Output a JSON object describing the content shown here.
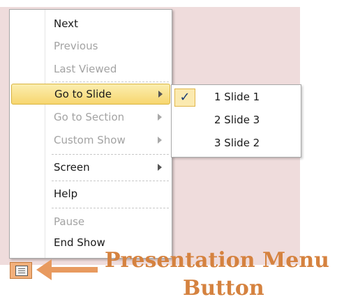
{
  "menu": {
    "items": [
      {
        "label": "Next",
        "enabled": true
      },
      {
        "label": "Previous",
        "enabled": false
      },
      {
        "label": "Last Viewed",
        "enabled": false
      },
      {
        "label": "Go to Slide",
        "enabled": true,
        "highlighted": true,
        "submenu": true
      },
      {
        "label": "Go to Section",
        "enabled": false,
        "submenu": true
      },
      {
        "label": "Custom Show",
        "enabled": false,
        "submenu": true
      },
      {
        "label": "Screen",
        "enabled": true,
        "submenu": true
      },
      {
        "label": "Help",
        "enabled": true
      },
      {
        "label": "Pause",
        "enabled": false
      },
      {
        "label": "End Show",
        "enabled": true
      }
    ]
  },
  "submenu": {
    "items": [
      {
        "label": "1  Slide 1",
        "checked": true
      },
      {
        "label": "2 Slide 3",
        "checked": false
      },
      {
        "label": "3 Slide 2",
        "checked": false
      }
    ],
    "check_glyph": "✓"
  },
  "caption": {
    "line1": "Presentation  Menu",
    "line2": "Button"
  },
  "colors": {
    "slide_background": "#efdcdc",
    "highlight": "#f7d66f",
    "callout": "#d5823f"
  },
  "icons": {
    "presentation_menu": "presentation-menu-icon",
    "submenu_arrow": "chevron-right-icon",
    "callout_arrow": "arrow-left-icon"
  }
}
